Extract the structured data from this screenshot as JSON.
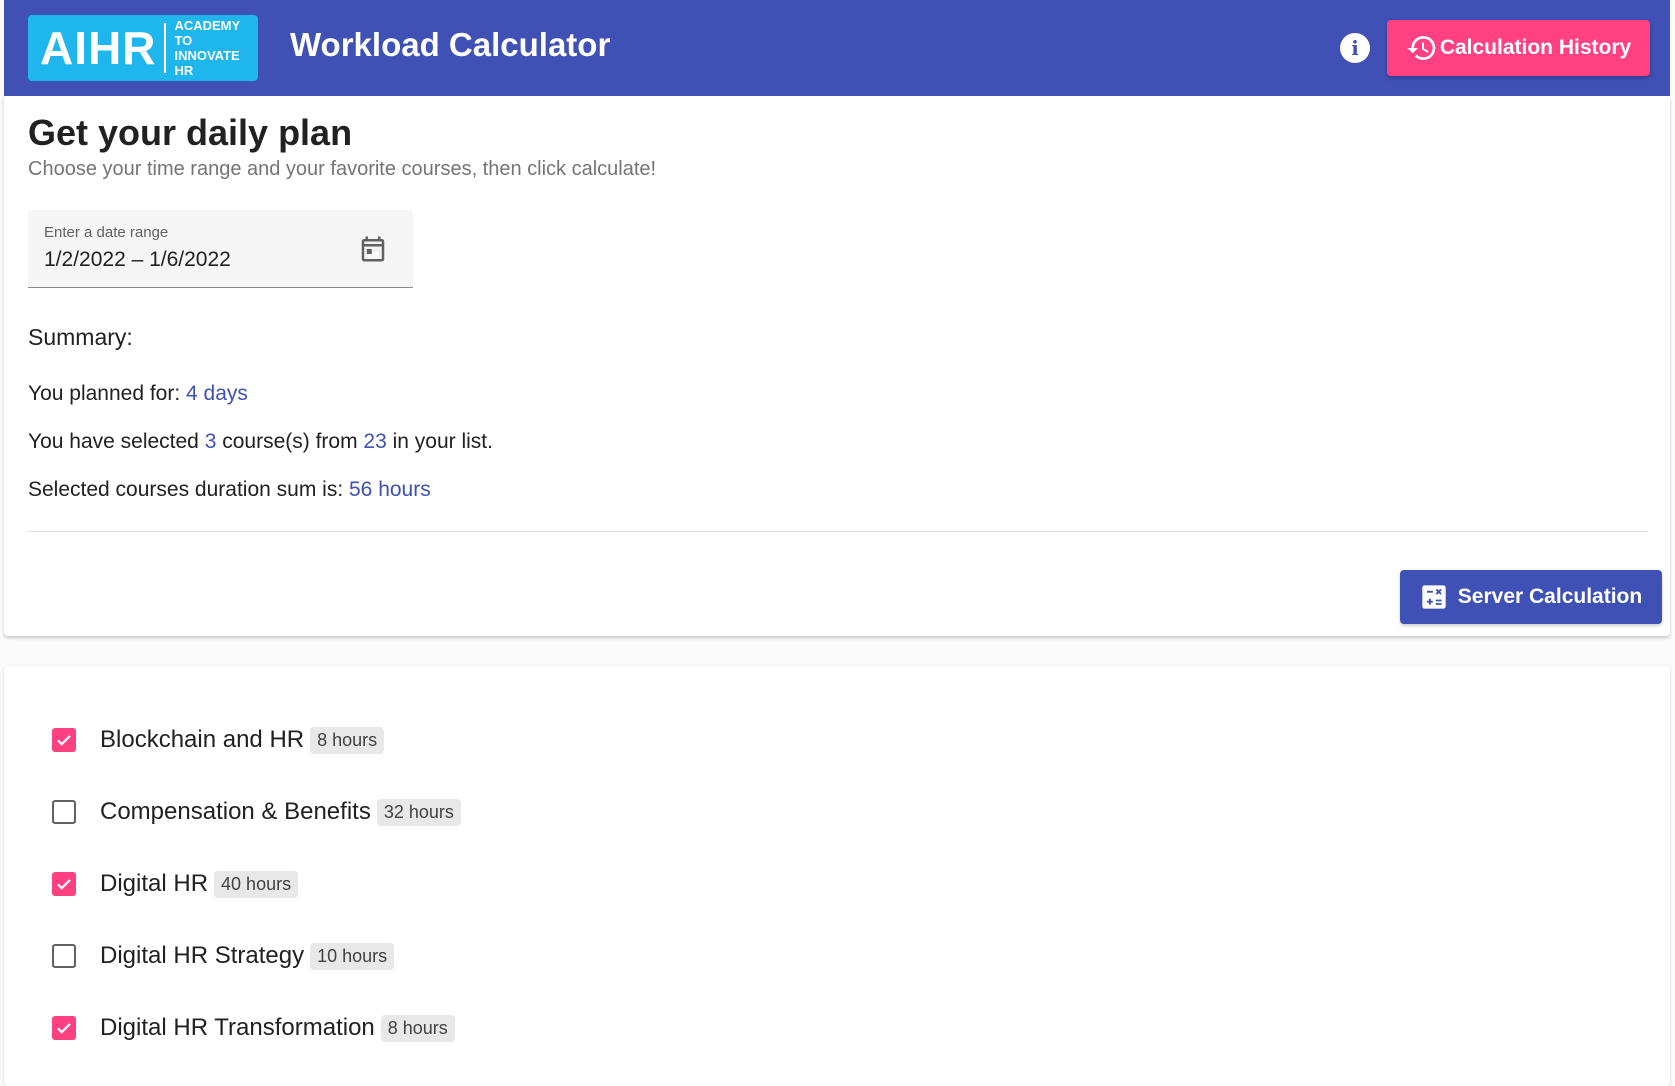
{
  "header": {
    "logo_big": "AIHR",
    "logo_line1": "Academy to",
    "logo_line2": "Innovate HR",
    "title": "Workload Calculator",
    "info_icon": "info-icon",
    "history_icon": "history-icon",
    "history_label": "Calculation History",
    "color": "#3f51b5",
    "accent": "#ff4081"
  },
  "plan": {
    "title": "Get your daily plan",
    "subtitle": "Choose your time range and your favorite courses, then click calculate!",
    "date_field": {
      "label": "Enter a date range",
      "value": "1/2/2022 – 1/6/2022",
      "icon": "calendar-icon"
    },
    "summary": {
      "title": "Summary:",
      "planned_prefix": "You planned for: ",
      "planned_value": "4 days",
      "selected_prefix": "You have selected ",
      "selected_count": "3",
      "selected_mid": " course(s) from ",
      "total_count": "23",
      "selected_suffix": " in your list.",
      "duration_prefix": "Selected courses duration sum is: ",
      "duration_value": "56 hours"
    },
    "server_button": {
      "label": "Server Calculation",
      "icon": "calculator-icon"
    }
  },
  "courses": [
    {
      "name": "Blockchain and HR",
      "hours": "8 hours",
      "checked": true
    },
    {
      "name": "Compensation & Benefits",
      "hours": "32 hours",
      "checked": false
    },
    {
      "name": "Digital HR",
      "hours": "40 hours",
      "checked": true
    },
    {
      "name": "Digital HR Strategy",
      "hours": "10 hours",
      "checked": false
    },
    {
      "name": "Digital HR Transformation",
      "hours": "8 hours",
      "checked": true
    }
  ]
}
